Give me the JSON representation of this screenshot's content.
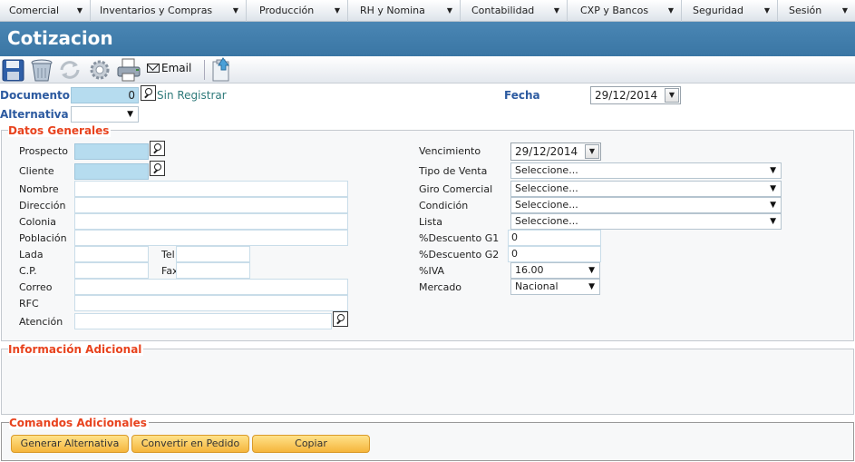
{
  "menu": {
    "items": [
      {
        "label": "Comercial"
      },
      {
        "label": "Inventarios y Compras"
      },
      {
        "label": "Producción"
      },
      {
        "label": "RH y Nomina"
      },
      {
        "label": "Contabilidad"
      },
      {
        "label": "CXP y Bancos"
      },
      {
        "label": "Seguridad"
      },
      {
        "label": "Sesión"
      }
    ],
    "arrow": "▼"
  },
  "header": {
    "title": "Cotizacion"
  },
  "toolbar": {
    "email_label": "Email"
  },
  "top": {
    "documento_label": "Documento",
    "documento_value": "0",
    "sin_registrar": "Sin Registrar",
    "alternativa_label": "Alternativa",
    "fecha_label": "Fecha",
    "fecha_value": "29/12/2014"
  },
  "datos": {
    "title": "Datos Generales",
    "prospecto_label": "Prospecto",
    "cliente_label": "Cliente",
    "nombre_label": "Nombre",
    "direccion_label": "Dirección",
    "colonia_label": "Colonia",
    "poblacion_label": "Población",
    "lada_label": "Lada",
    "tel_label": "Tel",
    "cp_label": "C.P.",
    "fax_label": "Fax",
    "correo_label": "Correo",
    "rfc_label": "RFC",
    "atencion_label": "Atención",
    "vencimiento_label": "Vencimiento",
    "vencimiento_value": "29/12/2014",
    "tipo_venta_label": "Tipo de Venta",
    "tipo_venta_value": "Seleccione...",
    "giro_label": "Giro Comercial",
    "giro_value": "Seleccione...",
    "condicion_label": "Condición",
    "condicion_value": "Seleccione...",
    "lista_label": "Lista",
    "lista_value": "Seleccione...",
    "desc_g1_label": "%Descuento  G1",
    "desc_g1_value": "0",
    "desc_g2_label": "%Descuento  G2",
    "desc_g2_value": "0",
    "iva_label": "%IVA",
    "iva_value": "16.00",
    "mercado_label": "Mercado",
    "mercado_value": "Nacional"
  },
  "info": {
    "title": "Información Adicional"
  },
  "comandos": {
    "title": "Comandos Adicionales",
    "generar_label": "Generar Alternativa",
    "convertir_label": "Convertir en Pedido",
    "copiar_label": "Copiar"
  },
  "colors": {
    "header_bg": "#3a76a4",
    "section_title": "#e8431e",
    "label_blue": "#2c5aa0",
    "button": "#f5b53c"
  }
}
